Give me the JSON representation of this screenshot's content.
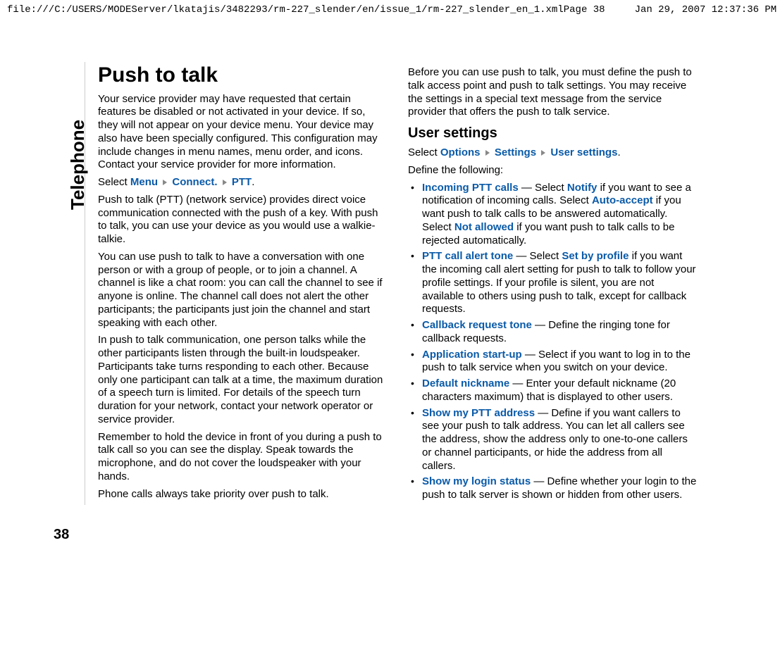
{
  "header": {
    "path": "file:///C:/USERS/MODEServer/lkatajis/3482293/rm-227_slender/en/issue_1/rm-227_slender_en_1.xml",
    "page": "Page 38",
    "timestamp": "Jan 29, 2007 12:37:36 PM"
  },
  "sidebar": {
    "section": "Telephone",
    "pageNumber": "38"
  },
  "col1": {
    "title": "Push to talk",
    "intro": "Your service provider may have requested that certain features be disabled or not activated in your device. If so, they will not appear on your device menu. Your device may also have been specially configured. This configuration may include changes in menu names, menu order, and icons. Contact your service provider for more information.",
    "selectPrefix": "Select ",
    "menu1": "Menu",
    "menu2": "Connect.",
    "menu3": "PTT",
    "p2": "Push to talk (PTT) (network service) provides direct voice communication connected with the push of a key. With push to talk, you can use your device as you would use a walkie-talkie.",
    "p3": "You can use push to talk to have a conversation with one person or with a group of people, or to join a channel. A channel is like a chat room: you can call the channel to see if anyone is online. The channel call does not alert the other participants; the participants just join the channel and start speaking with each other.",
    "p4": "In push to talk communication, one person talks while the other participants listen through the built-in loudspeaker. Participants take turns responding to each other. Because only one participant can talk at a time, the maximum duration of a speech turn is limited. For details of the speech turn duration for your network, contact your network operator or service provider.",
    "p5": "Remember to hold the device in front of you during a push to talk call so you can see the display. Speak towards the microphone, and do not cover the loudspeaker with your hands.",
    "p6": "Phone calls always take priority over push to talk."
  },
  "col2": {
    "intro": "Before you can use push to talk, you must define the push to talk access point and push to talk settings. You may receive the settings in a special text message from the service provider that offers the push to talk service.",
    "h2": "User settings",
    "selectPrefix": "Select ",
    "m1": "Options",
    "m2": "Settings",
    "m3": "User settings",
    "define": "Define the following:",
    "items": [
      {
        "term": "Incoming PTT calls",
        "t1": " — Select ",
        "o1": "Notify",
        "t2": " if you want to see a notification of incoming calls. Select ",
        "o2": "Auto-accept",
        "t3": " if you want push to talk calls to be answered automatically. Select ",
        "o3": "Not allowed",
        "t4": " if you want push to talk calls to be rejected automatically."
      },
      {
        "term": "PTT call alert tone",
        "t1": " — Select ",
        "o1": "Set by profile",
        "t2": " if you want the incoming call alert setting for push to talk to follow your profile settings. If your profile is silent, you are not available to others using push to talk, except for callback requests."
      },
      {
        "term": "Callback request tone",
        "t1": " — Define the ringing tone for callback requests."
      },
      {
        "term": "Application start-up",
        "t1": " — Select if you want to log in to the push to talk service when you switch on your device."
      },
      {
        "term": "Default nickname",
        "t1": " — Enter your default nickname (20 characters maximum) that is displayed to other users."
      },
      {
        "term": "Show my PTT address",
        "t1": " — Define if you want callers to see your push to talk address. You can let all callers see the address, show the address only to one-to-one callers or channel participants, or hide the address from all callers."
      },
      {
        "term": "Show my login status",
        "t1": " — Define whether your login to the push to talk server is shown or hidden from other users."
      }
    ]
  }
}
